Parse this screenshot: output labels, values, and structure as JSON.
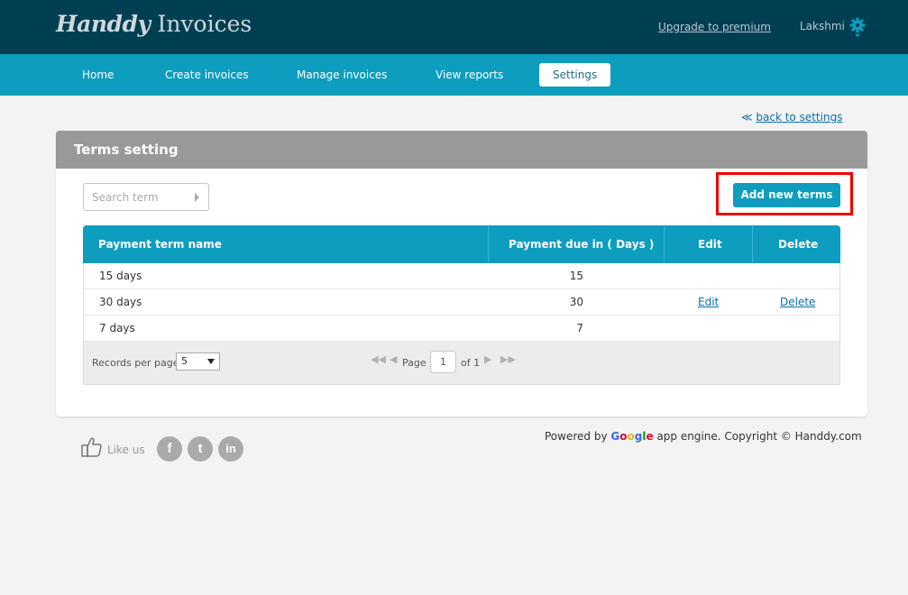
{
  "header": {
    "logo_script": "Handdy",
    "logo_plain": "Invoices",
    "upgrade_link": "Upgrade to premium",
    "username": "Lakshmi"
  },
  "nav": {
    "items": [
      {
        "label": "Home",
        "active": false
      },
      {
        "label": "Create invoices",
        "active": false
      },
      {
        "label": "Manage invoices",
        "active": false
      },
      {
        "label": "View reports",
        "active": false
      },
      {
        "label": "Settings",
        "active": true
      }
    ]
  },
  "back_link": {
    "arrow": "≪",
    "label": "back to settings"
  },
  "panel": {
    "title": "Terms setting",
    "search_placeholder": "Search term",
    "add_button": "Add new terms"
  },
  "table": {
    "columns": [
      "Payment term name",
      "Payment due in ( Days )",
      "Edit",
      "Delete"
    ],
    "rows": [
      {
        "name": "15 days",
        "days": "15",
        "edit": "",
        "delete": ""
      },
      {
        "name": "30 days",
        "days": "30",
        "edit": "Edit",
        "delete": "Delete"
      },
      {
        "name": "7 days",
        "days": "7",
        "edit": "",
        "delete": ""
      }
    ]
  },
  "pager": {
    "records_label": "Records per page",
    "records_value": "5",
    "page_label": "Page",
    "page_value": "1",
    "of_label": "of 1"
  },
  "footer": {
    "like_label": "Like us",
    "social": [
      "f",
      "t",
      "in"
    ],
    "powered_prefix": "Powered by",
    "google_letters": [
      "G",
      "o",
      "o",
      "g",
      "l",
      "e"
    ],
    "powered_suffix": "app engine. Copyright © Handdy.com"
  },
  "colors": {
    "topbar": "#003e52",
    "navbar": "#0c9dbf",
    "header_gray": "#999999",
    "highlight": "#ee0000"
  }
}
